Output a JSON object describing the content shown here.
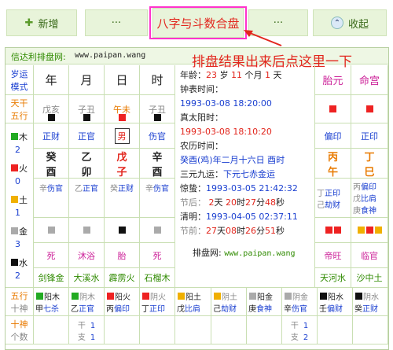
{
  "toolbar": {
    "new_label": "新增",
    "more_left": "···",
    "center_title": "八字与斗数合盘",
    "more_right": "···",
    "collapse_label": "收起"
  },
  "annotation": "排盘结果出来后点这里一下",
  "header": {
    "site_label": "信达利排盘网:",
    "site_url": "www.paipan.wang"
  },
  "grid": {
    "corner": [
      "岁运",
      "模式"
    ],
    "pillars_head": [
      "年",
      "月",
      "日",
      "时"
    ],
    "tiangan_label": [
      "天干",
      "五行"
    ],
    "tiangan_wuxing": [
      "戊亥",
      "子丑",
      "午未",
      "子丑"
    ],
    "shishen_top": [
      "正财",
      "正官",
      "男",
      "伤官"
    ],
    "gan": [
      "癸",
      "乙",
      "戊",
      "辛"
    ],
    "zhi": [
      "酉",
      "卯",
      "子",
      "酉"
    ],
    "canggan": [
      {
        "g": "辛",
        "s": "伤官"
      },
      {
        "g": "乙",
        "s": "正官"
      },
      {
        "g": "癸",
        "s": "正财"
      },
      {
        "g": "辛",
        "s": "伤官"
      }
    ],
    "changsheng": [
      "死",
      "沐浴",
      "胎",
      "死"
    ],
    "nayin": [
      "剑锋金",
      "大溪水",
      "霹雳火",
      "石榴木"
    ]
  },
  "wuxing_counts": [
    {
      "name": "木",
      "count": "2"
    },
    {
      "name": "火",
      "count": "0"
    },
    {
      "name": "土",
      "count": "1"
    },
    {
      "name": "金",
      "count": "3"
    },
    {
      "name": "水",
      "count": "2"
    }
  ],
  "info": {
    "age_prefix": "年龄：",
    "age_years": "23",
    "age_y": "岁",
    "age_months": "11",
    "age_m": "个月",
    "age_days": "1",
    "age_d": "天",
    "clock_label": "钟表时间：",
    "clock_time": "1993-03-08 18:20:00",
    "solar_label": "真太阳时：",
    "solar_time": "1993-03-08 18:10:20",
    "lunar_label": "农历时间：",
    "lunar_time": "癸酉(鸡)年二月十六日 酉时",
    "sanyuan_label": "三元九运：",
    "sanyuan_value": "下元七赤金运",
    "jingzhe_label": "惊蛰：",
    "jingzhe_time": "1993-03-05 21:42:32",
    "jiehou_label": "节后：",
    "jiehou_d": "2",
    "jiehou_h": "20",
    "jiehou_m": "27",
    "jiehou_s": "48",
    "qingming_label": "清明：",
    "qingming_time": "1993-04-05 02:37:11",
    "jieqian_label": "节前：",
    "jieqian_d": "27",
    "jieqian_h": "08",
    "jieqian_m": "26",
    "jieqian_s": "51",
    "u_day": "天",
    "u_hour": "时",
    "u_min": "分",
    "u_sec": "秒",
    "footer_label": "排盘网:",
    "footer_url": "www.paipan.wang"
  },
  "right": {
    "head": [
      "胎元",
      "命宫"
    ],
    "shishen": [
      "偏印",
      "正印"
    ],
    "ganzhi_a": [
      "丙",
      "午"
    ],
    "ganzhi_b": [
      "丁",
      "巳"
    ],
    "canggan_a": [
      {
        "g": "丁",
        "s": "正印"
      },
      {
        "g": "己",
        "s": "劫财"
      }
    ],
    "canggan_b": [
      {
        "g": "丙",
        "s": "偏印"
      },
      {
        "g": "戊",
        "s": "比肩"
      },
      {
        "g": "庚",
        "s": "食神"
      }
    ],
    "changsheng": [
      "帝旺",
      "临官"
    ],
    "nayin": [
      "天河水",
      "沙中土"
    ]
  },
  "bottom": {
    "row1_label": [
      "五行",
      "十神"
    ],
    "row2_label": [
      "十神",
      "个数"
    ],
    "items": [
      {
        "a": "阳木",
        "b": "甲",
        "c": "七杀"
      },
      {
        "a": "阴木",
        "b": "乙",
        "c": "正官"
      },
      {
        "a": "阳火",
        "b": "丙",
        "c": "偏印"
      },
      {
        "a": "阴火",
        "b": "丁",
        "c": "正印"
      },
      {
        "a": "阳土",
        "b": "戊",
        "c": "比肩"
      },
      {
        "a": "阴土",
        "b": "己",
        "c": "劫财"
      },
      {
        "a": "阳金",
        "b": "庚",
        "c": "食神"
      },
      {
        "a": "阴金",
        "b": "辛",
        "c": "伤官"
      },
      {
        "a": "阳水",
        "b": "壬",
        "c": "偏财"
      },
      {
        "a": "阴水",
        "b": "癸",
        "c": "正财"
      }
    ],
    "counts": [
      {
        "gan_label": "干",
        "gan": "1",
        "zhi_label": "支",
        "zhi": "1"
      },
      {
        "gan_label": "干",
        "gan": "1",
        "zhi_label": "支",
        "zhi": "2"
      }
    ]
  },
  "colors": {
    "accent_green": "#e8f4da",
    "highlight_pink": "#ff33cc",
    "red": "#e2261d",
    "blue": "#1a3fd0"
  }
}
